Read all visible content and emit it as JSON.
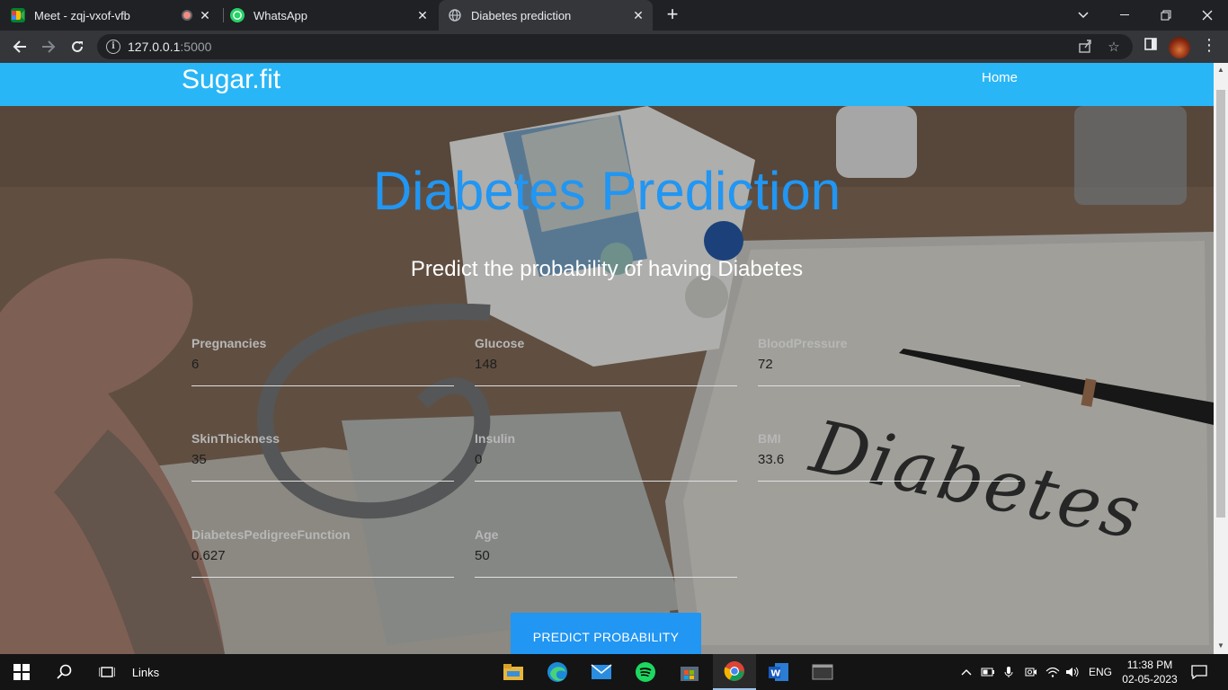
{
  "browser": {
    "tabs": [
      {
        "title": "Meet - zqj-vxof-vfb",
        "icon": "google-meet-icon"
      },
      {
        "title": "WhatsApp",
        "icon": "whatsapp-icon"
      },
      {
        "title": "Diabetes prediction",
        "icon": "globe-icon",
        "active": true
      }
    ],
    "url_host": "127.0.0.1",
    "url_port": ":5000"
  },
  "site": {
    "brand": "Sugar.fit",
    "nav_home": "Home",
    "title": "Diabetes Prediction",
    "subtitle": "Predict the probability of having Diabetes",
    "accent_color": "#2196f3",
    "navbar_color": "#29b6f6"
  },
  "form": {
    "fields": [
      {
        "label": "Pregnancies",
        "value": "6"
      },
      {
        "label": "Glucose",
        "value": "148"
      },
      {
        "label": "BloodPressure",
        "value": "72"
      },
      {
        "label": "SkinThickness",
        "value": "35"
      },
      {
        "label": "Insulin",
        "value": "0"
      },
      {
        "label": "BMI",
        "value": "33.6"
      },
      {
        "label": "DiabetesPedigreeFunction",
        "value": "0.627"
      },
      {
        "label": "Age",
        "value": "50"
      }
    ],
    "submit_label": "PREDICT PROBABILITY"
  },
  "background_text": "Diabetes",
  "taskbar": {
    "search_label": "Links",
    "language": "ENG",
    "time": "11:38 PM",
    "date": "02-05-2023"
  }
}
